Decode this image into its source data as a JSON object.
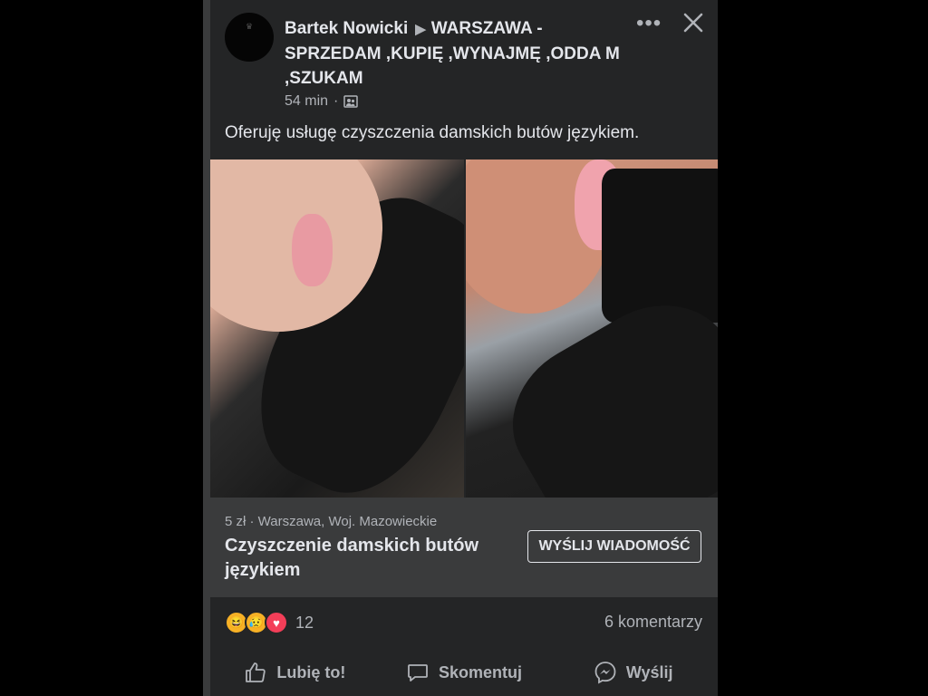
{
  "post": {
    "author": "Bartek Nowicki",
    "group": "WARSZAWA - SPRZEDAM ,KUPIĘ ,WYNAJMĘ ,ODDA M ,SZUKAM",
    "time": "54 min",
    "separator": "·",
    "text": "Oferuję usługę czyszczenia damskich butów językiem."
  },
  "listing": {
    "price_location": "5 zł · Warszawa, Woj. Mazowieckie",
    "title": "Czyszczenie damskich butów językiem",
    "message_button": "WYŚLIJ WIADOMOŚĆ"
  },
  "reactions": {
    "count": "12",
    "comments": "6 komentarzy"
  },
  "actions": {
    "like": "Lubię to!",
    "comment": "Skomentuj",
    "share": "Wyślij"
  },
  "icons": {
    "more": "more-icon",
    "close": "close-icon",
    "audience": "group-audience-icon",
    "like": "thumbs-up-icon",
    "comment": "comment-bubble-icon",
    "share": "messenger-icon"
  }
}
